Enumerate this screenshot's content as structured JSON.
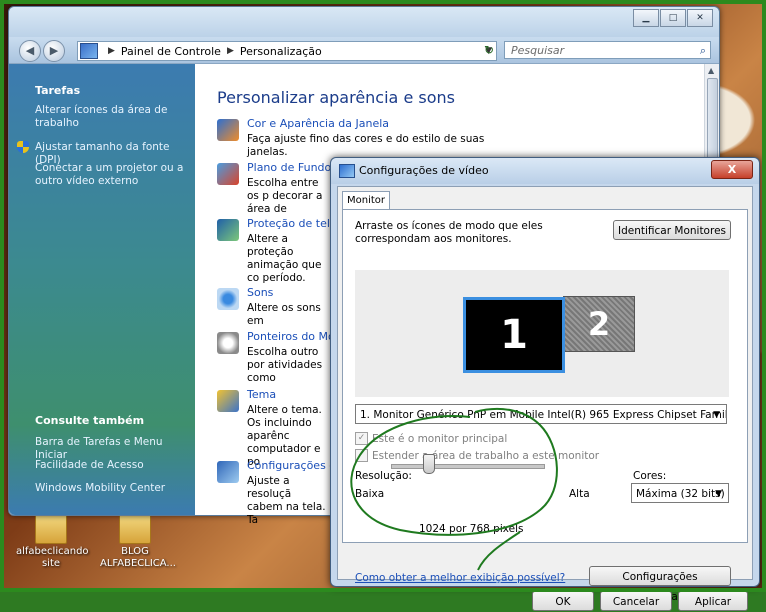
{
  "desktop": {
    "icons": [
      {
        "label": "alfabeclicando site"
      },
      {
        "label": "BLOG ALFABECLICA..."
      }
    ]
  },
  "control_panel": {
    "breadcrumb": [
      "Painel de Controle",
      "Personalização"
    ],
    "search_placeholder": "Pesquisar",
    "sidebar": {
      "tasks_heading": "Tarefas",
      "tasks": [
        "Alterar ícones da área de trabalho",
        "Ajustar tamanho da fonte (DPI)",
        "Conectar a um projetor ou a outro vídeo externo"
      ],
      "see_also_heading": "Consulte também",
      "see_also": [
        "Barra de Tarefas e Menu Iniciar",
        "Facilidade de Acesso",
        "Windows Mobility Center"
      ]
    },
    "main_title": "Personalizar aparência e sons",
    "items": [
      {
        "title": "Cor e Aparência da Janela",
        "desc": "Faça ajuste fino das cores e do estilo de suas janelas."
      },
      {
        "title": "Plano de Fundo d",
        "desc": "Escolha entre os p decorar a área de"
      },
      {
        "title": "Proteção de tela",
        "desc": "Altere a proteção animação que co período."
      },
      {
        "title": "Sons",
        "desc": "Altere os sons em"
      },
      {
        "title": "Ponteiros do Mou",
        "desc": "Escolha outro por atividades como"
      },
      {
        "title": "Tema",
        "desc": "Altere o tema. Os incluindo aparênc computador e po"
      },
      {
        "title": "Configurações d",
        "desc": "Ajuste a resoluçã cabem na tela. Ta"
      }
    ]
  },
  "display_dialog": {
    "title": "Configurações de vídeo",
    "close_label": "X",
    "tab": "Monitor",
    "instructions": "Arraste os ícones de modo que eles correspondam aos monitores.",
    "identify_button": "Identificar Monitores",
    "monitor_1": "1",
    "monitor_2": "2",
    "monitor_select": "1. Monitor Genérico PnP em Mobile Intel(R) 965 Express Chipset Family",
    "primary_checkbox": "Este é o monitor principal",
    "extend_checkbox": "Estender a área de trabalho a este monitor",
    "resolution_label": "Resolução:",
    "low_label": "Baixa",
    "high_label": "Alta",
    "resolution_value": "1024 por 768 pixels",
    "colors_label": "Cores:",
    "colors_select": "Máxima (32 bits)",
    "help_link": "Como obter a melhor exibição possível?",
    "advanced_button": "Configurações Avançadas...",
    "ok_button": "OK",
    "cancel_button": "Cancelar",
    "apply_button": "Aplicar"
  },
  "colors": {
    "link": "#1b4fb8",
    "annotation": "#1f7a1f",
    "monitor_selected_border": "#3b8fe0"
  }
}
